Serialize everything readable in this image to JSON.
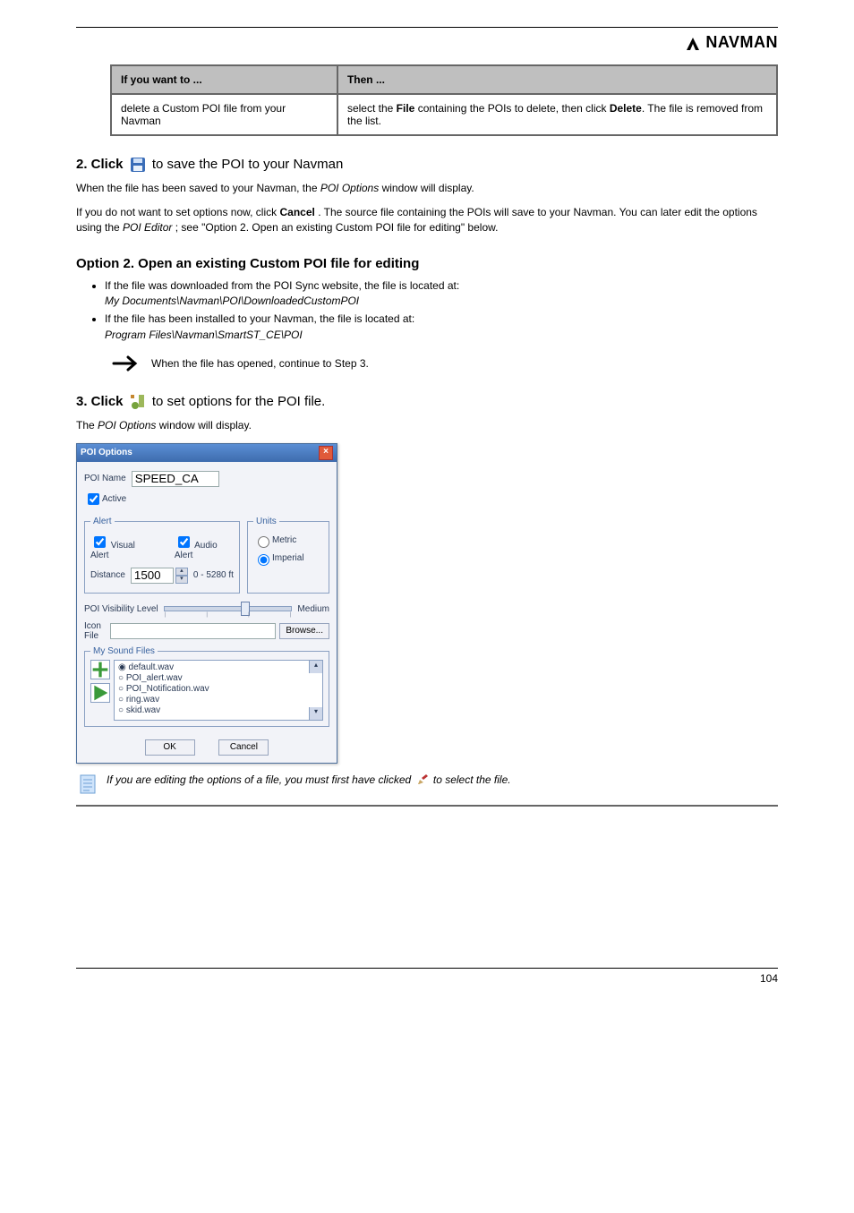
{
  "brand": "NAVMAN",
  "table": {
    "h1": "If you want to ...",
    "h2": "Then ...",
    "c1a": "delete a Custom POI file from your Navman",
    "c1b_pre": "select the",
    "c1b_bold": "File",
    "c1b_mid": "containing the POIs to delete, then click",
    "c1b_bold2": "Delete",
    "c1b_post": ".\nThe file is removed from the list."
  },
  "step2": {
    "heading": "2. Click",
    "save_btn": "to save the POI to your Navman",
    "para2_a": "When the file has been saved to your Navman, the",
    "para2_i": "POI Options",
    "para2_b": "window will display.",
    "para3_a": "If you do not want to set options now, click",
    "para3_bold": "Cancel",
    "para3_b": ". The source file containing the POIs will save to your Navman. You can later edit the options using the",
    "para3_i": "POI Editor",
    "para3_c": "; see \"Option 2. Open an existing Custom POI file for editing\" below."
  },
  "opt2": {
    "heading": "Option 2. Open an existing Custom POI file for editing",
    "b1_pre": "If the file was downloaded from the POI Sync website, the file is located at:",
    "b1_i": "My Documents\\Navman\\POI\\DownloadedCustomPOI",
    "b2_pre": "If the file has been installed to your Navman, the file is located at:",
    "b2_i": "Program Files\\Navman\\SmartST_CE\\POI"
  },
  "arrow_text": "When the file has opened, continue to Step 3.",
  "step3": {
    "heading": "3. Click",
    "rest": "to set options for the POI file.",
    "para_a": "The",
    "para_i": "POI Options",
    "para_b": "window will display."
  },
  "dialog": {
    "title": "POI Options",
    "poi_name_label": "POI Name",
    "poi_name_value": "SPEED_CA",
    "active": "Active",
    "alert_legend": "Alert",
    "visual_alert": "Visual Alert",
    "audio_alert": "Audio Alert",
    "distance_label": "Distance",
    "distance_value": "1500",
    "distance_range": "0 - 5280 ft",
    "units_legend": "Units",
    "metric": "Metric",
    "imperial": "Imperial",
    "visibility_label": "POI Visibility Level",
    "visibility_value": "Medium",
    "icon_file_label": "Icon File",
    "browse": "Browse...",
    "sound_legend": "My Sound Files",
    "sounds": [
      "default.wav",
      "POI_alert.wav",
      "POI_Notification.wav",
      "ring.wav",
      "skid.wav"
    ],
    "ok": "OK",
    "cancel": "Cancel"
  },
  "note": {
    "pre": "If you are editing the options of a file, you must first have clicked",
    "mid": "to select the file.",
    "post": ""
  },
  "footer_page": "104"
}
